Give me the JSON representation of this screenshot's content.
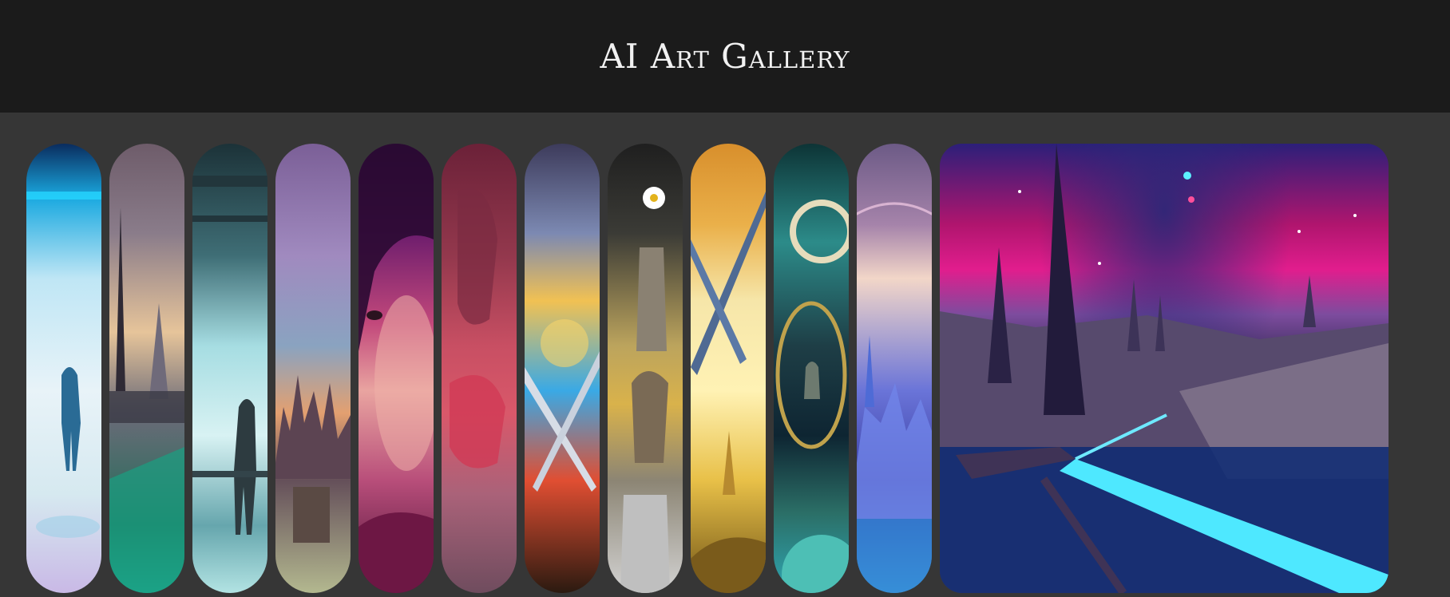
{
  "header": {
    "title": "AI Art Gallery"
  },
  "gallery": {
    "panels": [
      {
        "name": "figure-in-blue-light"
      },
      {
        "name": "city-towers-dusk"
      },
      {
        "name": "figure-at-waterfall-window"
      },
      {
        "name": "castle-in-clouds"
      },
      {
        "name": "woman-portrait-pink"
      },
      {
        "name": "red-helmet-abstract"
      },
      {
        "name": "crossed-swords-explosion"
      },
      {
        "name": "daisy-robot-vase"
      },
      {
        "name": "crossed-blades-golden"
      },
      {
        "name": "cosmic-circles-ornament"
      },
      {
        "name": "futuristic-city-planet"
      },
      {
        "name": "neon-spire-landscape",
        "expanded": true
      }
    ]
  },
  "colors": {
    "header_bg": "#1b1b1b",
    "page_bg": "#363636",
    "title": "#f2f2f2"
  }
}
